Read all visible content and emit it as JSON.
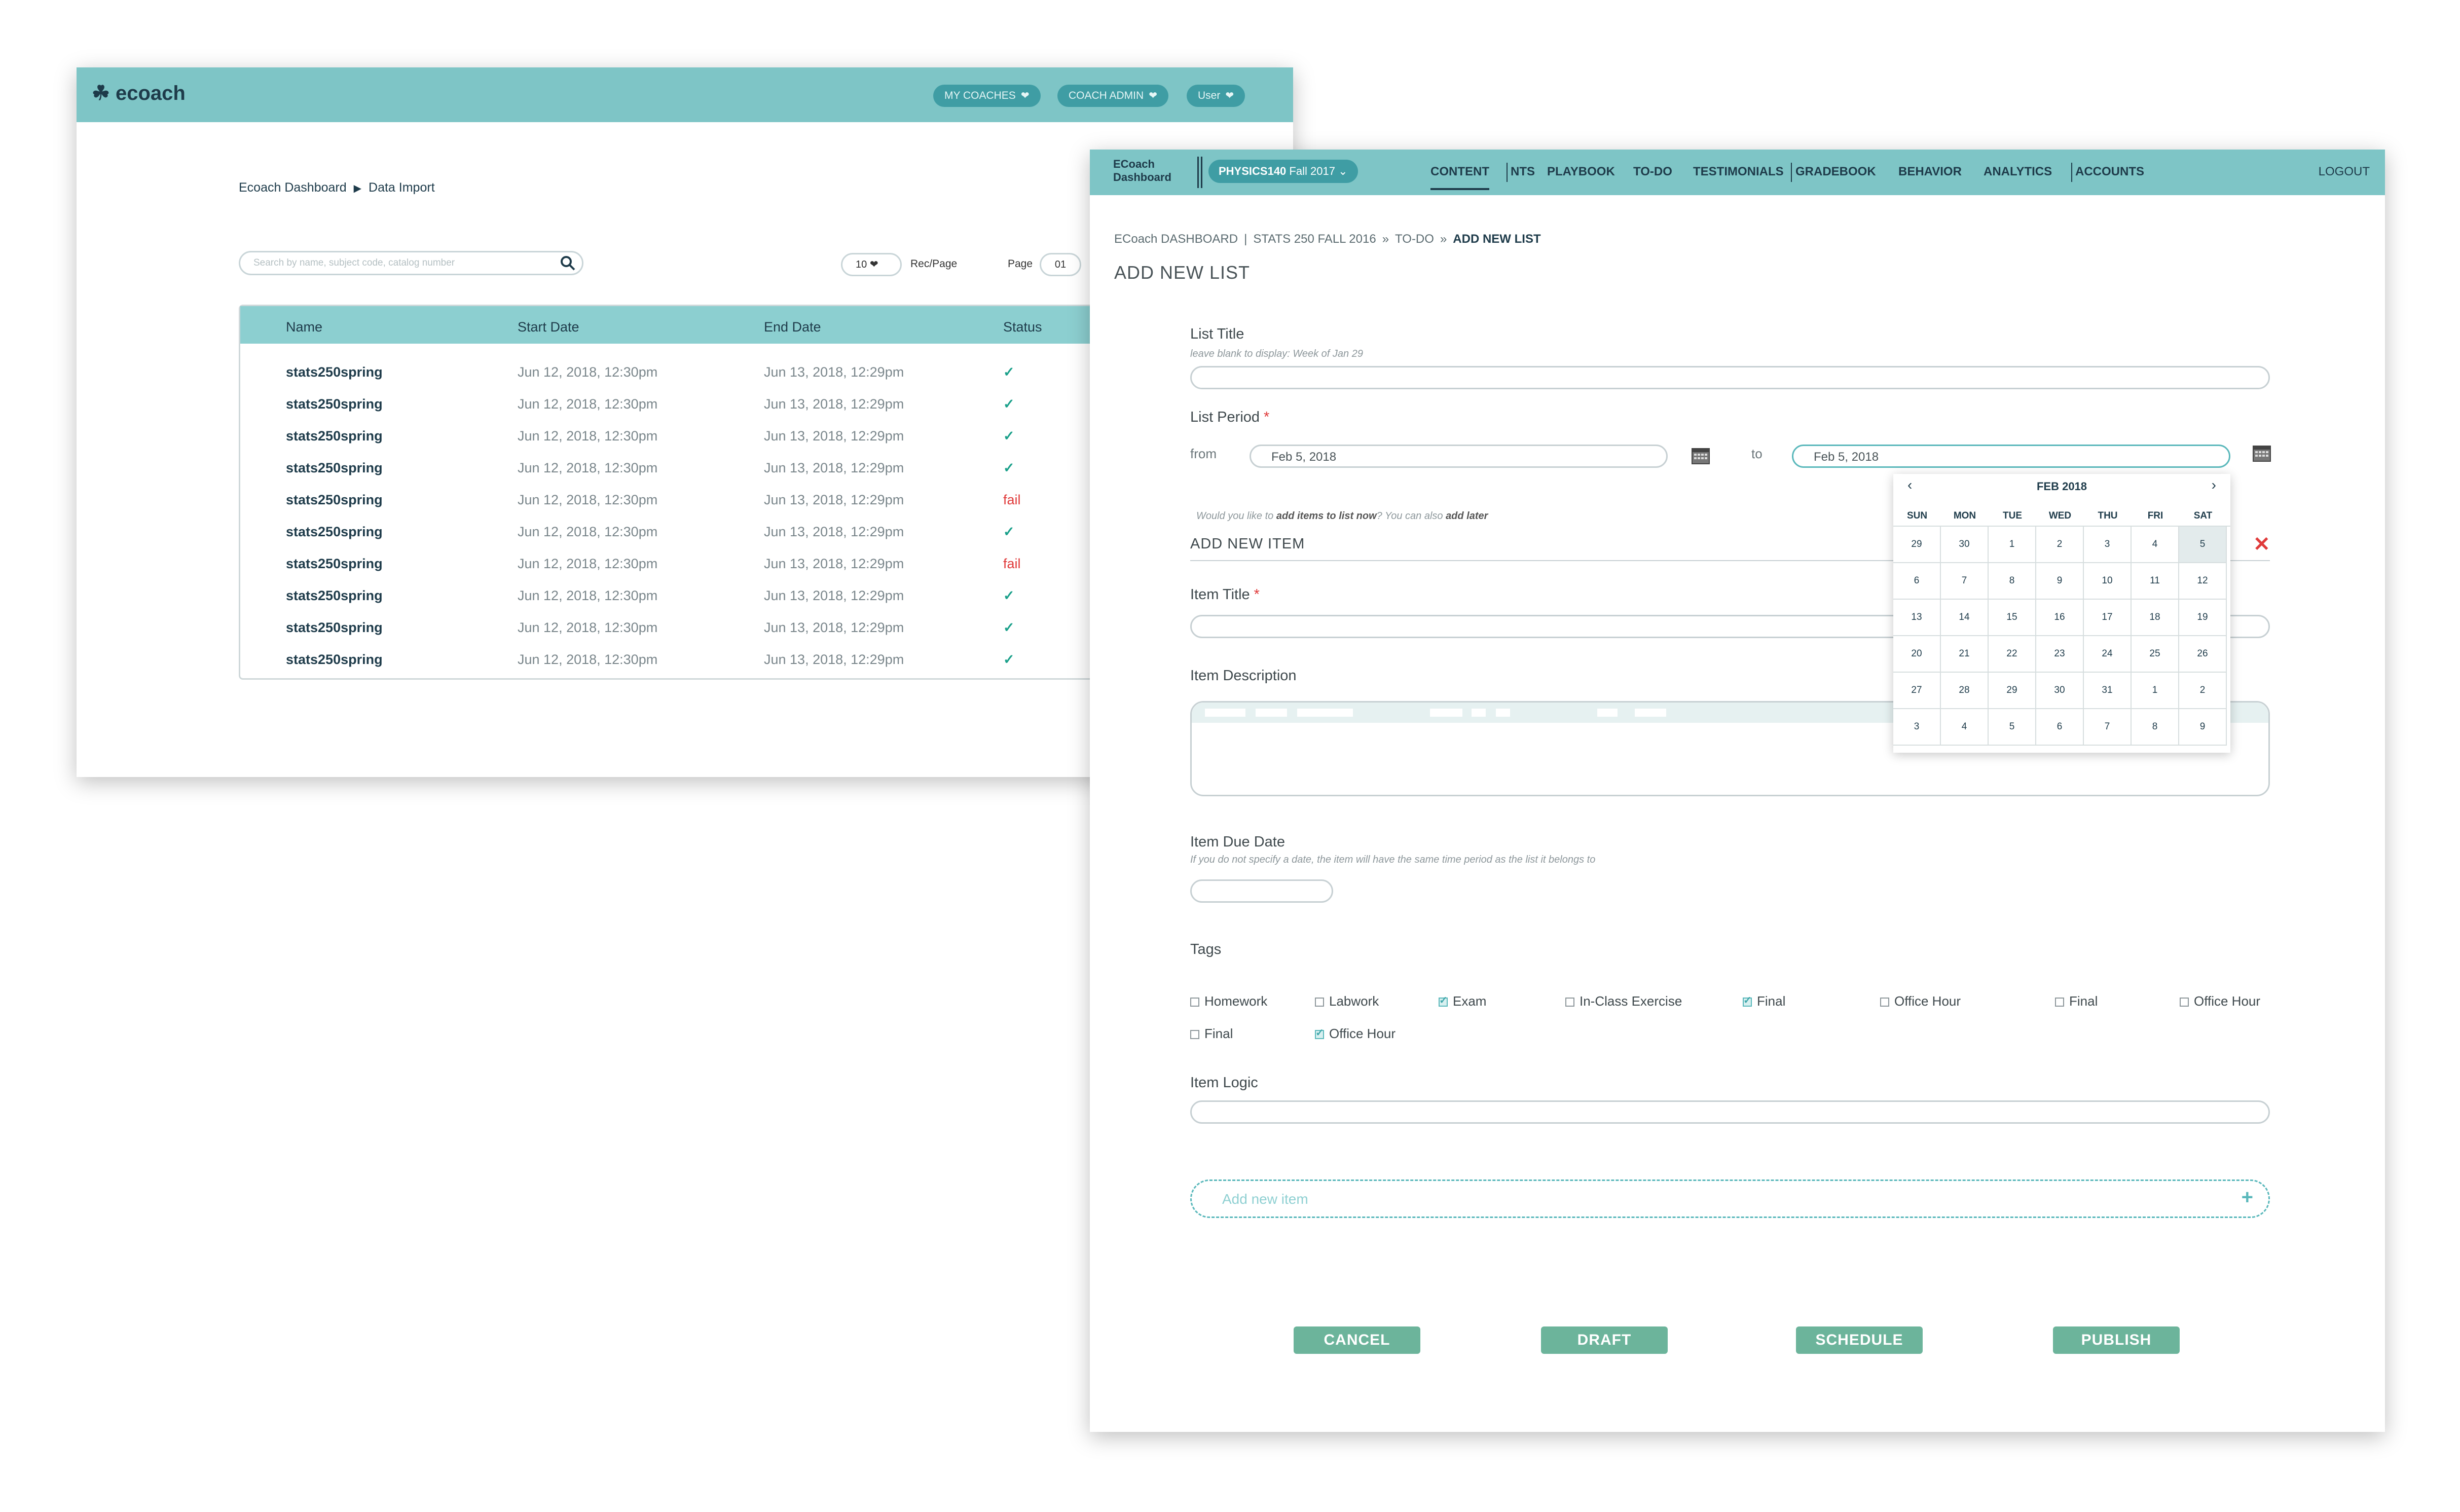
{
  "back_window": {
    "logo": "ecoach",
    "nav": [
      {
        "label": "MY COACHES",
        "icon": "chevron-down-icon"
      },
      {
        "label": "COACH ADMIN",
        "icon": "chevron-down-icon"
      },
      {
        "label": "User",
        "icon": "chevron-down-icon"
      }
    ],
    "breadcrumb": [
      "Ecoach Dashboard",
      "Data Import"
    ],
    "search": {
      "placeholder": "Search by  name, subject code, catalog number",
      "icon": "search-icon"
    },
    "rec_per_page": {
      "value": "10",
      "label": "Rec/Page"
    },
    "page": {
      "label": "Page",
      "value": "01"
    },
    "table": {
      "columns": [
        "Name",
        "Start Date",
        "End Date",
        "Status"
      ],
      "rows": [
        {
          "name": "stats250spring",
          "start": "Jun 12, 2018, 12:30pm",
          "end": "Jun 13, 2018, 12:29pm",
          "status": "✓"
        },
        {
          "name": "stats250spring",
          "start": "Jun 12, 2018, 12:30pm",
          "end": "Jun 13, 2018, 12:29pm",
          "status": "✓"
        },
        {
          "name": "stats250spring",
          "start": "Jun 12, 2018, 12:30pm",
          "end": "Jun 13, 2018, 12:29pm",
          "status": "✓"
        },
        {
          "name": "stats250spring",
          "start": "Jun 12, 2018, 12:30pm",
          "end": "Jun 13, 2018, 12:29pm",
          "status": "✓"
        },
        {
          "name": "stats250spring",
          "start": "Jun 12, 2018, 12:30pm",
          "end": "Jun 13, 2018, 12:29pm",
          "status": "fail"
        },
        {
          "name": "stats250spring",
          "start": "Jun 12, 2018, 12:30pm",
          "end": "Jun 13, 2018, 12:29pm",
          "status": "✓"
        },
        {
          "name": "stats250spring",
          "start": "Jun 12, 2018, 12:30pm",
          "end": "Jun 13, 2018, 12:29pm",
          "status": "fail"
        },
        {
          "name": "stats250spring",
          "start": "Jun 12, 2018, 12:30pm",
          "end": "Jun 13, 2018, 12:29pm",
          "status": "✓"
        },
        {
          "name": "stats250spring",
          "start": "Jun 12, 2018, 12:30pm",
          "end": "Jun 13, 2018, 12:29pm",
          "status": "✓"
        },
        {
          "name": "stats250spring",
          "start": "Jun 12, 2018, 12:30pm",
          "end": "Jun 13, 2018, 12:29pm",
          "status": "✓"
        }
      ]
    }
  },
  "front_window": {
    "brand_line1": "ECoach",
    "brand_line2": "Dashboard",
    "course": {
      "code": "PHYSICS140",
      "term": "Fall 2017"
    },
    "nav": [
      "CONTENT",
      "NTS",
      "PLAYBOOK",
      "TO-DO",
      "TESTIMONIALS",
      "GRADEBOOK",
      "BEHAVIOR",
      "ANALYTICS",
      "ACCOUNTS"
    ],
    "active_nav": "CONTENT",
    "logout": "LOGOUT",
    "breadcrumb": [
      "ECoach DASHBOARD",
      "STATS 250 FALL 2016",
      "TO-DO",
      "ADD NEW LIST"
    ],
    "page_title": "ADD NEW LIST",
    "list_title": {
      "label": "List Title",
      "hint": "leave blank to display: Week of Jan 29"
    },
    "list_period": {
      "label": "List Period",
      "required": "*",
      "from_label": "from",
      "from_value": "Feb 5, 2018",
      "to_label": "to",
      "to_value": "Feb 5, 2018"
    },
    "add_items_hint": {
      "pre": "Would you like to ",
      "b1": "add items to list now",
      "mid": "? You can also ",
      "b2": "add later"
    },
    "add_new_item": "ADD NEW ITEM",
    "item_title": {
      "label": "Item Title",
      "required": "*"
    },
    "item_description": {
      "label": "Item Description"
    },
    "item_due_date": {
      "label": "Item Due Date",
      "hint": "If you do not specify a date, the item will have the same time period as the list it belongs to"
    },
    "tags": {
      "label": "Tags",
      "items": [
        {
          "label": "Homework",
          "checked": false
        },
        {
          "label": "Labwork",
          "checked": false
        },
        {
          "label": "Exam",
          "checked": true
        },
        {
          "label": "In-Class Exercise",
          "checked": false
        },
        {
          "label": "Final",
          "checked": true
        },
        {
          "label": "Office Hour",
          "checked": false
        },
        {
          "label": "Final",
          "checked": false
        },
        {
          "label": "Office Hour",
          "checked": false
        },
        {
          "label": "Final",
          "checked": false
        },
        {
          "label": "Office Hour",
          "checked": true
        }
      ]
    },
    "item_logic": {
      "label": "Item Logic"
    },
    "add_new_item_button": "Add new item",
    "buttons": [
      "CANCEL",
      "DRAFT",
      "SCHEDULE",
      "PUBLISH"
    ],
    "calendar": {
      "month": "FEB 2018",
      "prev": "‹",
      "next": "›",
      "dow": [
        "SUN",
        "MON",
        "TUE",
        "WED",
        "THU",
        "FRI",
        "SAT"
      ],
      "days": [
        [
          "29",
          "30",
          "1",
          "2",
          "3",
          "4",
          "5"
        ],
        [
          "6",
          "7",
          "8",
          "9",
          "10",
          "11",
          "12"
        ],
        [
          "13",
          "14",
          "15",
          "16",
          "17",
          "18",
          "19"
        ],
        [
          "20",
          "21",
          "22",
          "23",
          "24",
          "25",
          "26"
        ],
        [
          "27",
          "28",
          "29",
          "30",
          "31",
          "1",
          "2"
        ],
        [
          "3",
          "4",
          "5",
          "6",
          "7",
          "8",
          "9"
        ]
      ],
      "selected": "5"
    },
    "colors": {
      "header": "#7ec5c6",
      "accent": "#5ab8bb",
      "button": "#6cb49b",
      "error": "#e03a3a"
    }
  }
}
